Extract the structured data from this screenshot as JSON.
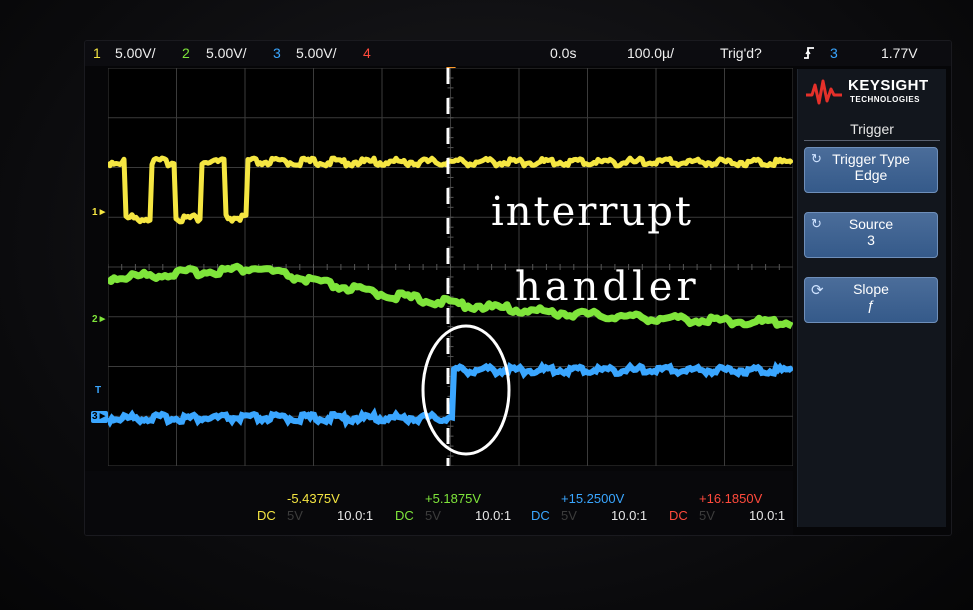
{
  "status_bar": {
    "ch1": {
      "num": "1",
      "scale": "5.00V/"
    },
    "ch2": {
      "num": "2",
      "scale": "5.00V/"
    },
    "ch3": {
      "num": "3",
      "scale": "5.00V/"
    },
    "ch4": {
      "num": "4"
    },
    "time_delay": "0.0s",
    "time_scale": "100.0µ/",
    "trigger_status": "Trig'd?",
    "trigger_slope_icon": "rising-edge-icon",
    "trigger_source": "3",
    "trigger_level": "1.77V"
  },
  "brand": {
    "name": "KEYSIGHT",
    "sub": "TECHNOLOGIES",
    "logo_color": "#e5302a"
  },
  "menu": {
    "title": "Trigger",
    "softkeys": [
      {
        "label": "Trigger Type",
        "value": "Edge"
      },
      {
        "label": "Source",
        "value": "3"
      },
      {
        "label": "Slope",
        "value": "ƒ"
      }
    ]
  },
  "left_markers": {
    "ch1": "1",
    "ch2": "2",
    "ch3": "3",
    "trig": "T"
  },
  "bottom_bar": {
    "channels": [
      {
        "coupling": "DC",
        "faint": "5V",
        "offset": "-5.4375V",
        "probe": "10.0:1",
        "color": "#f5e642"
      },
      {
        "coupling": "DC",
        "faint": "5V",
        "offset": "+5.1875V",
        "probe": "10.0:1",
        "color": "#7fe53b"
      },
      {
        "coupling": "DC",
        "faint": "5V",
        "offset": "+15.2500V",
        "probe": "10.0:1",
        "color": "#3aa6ff"
      },
      {
        "coupling": "DC",
        "faint": "5V",
        "offset": "+16.1850V",
        "probe": "10.0:1",
        "color": "#ff4a3c"
      }
    ]
  },
  "annotation": {
    "line1": "interrupt",
    "line2": "handler"
  },
  "colors": {
    "ch1": "#f5e642",
    "ch2": "#7fe53b",
    "ch3": "#3aa6ff",
    "ch4": "#ff4a3c",
    "grid": "#3b3b3b"
  }
}
